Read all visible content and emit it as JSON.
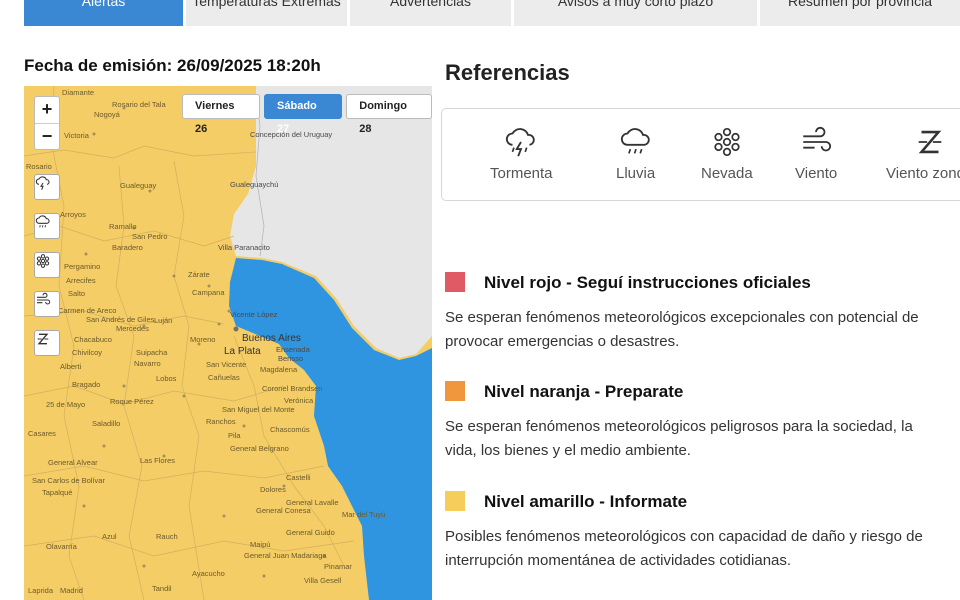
{
  "tabs": [
    {
      "label": "Alertas",
      "active": true
    },
    {
      "label": "Temperaturas Extremas",
      "active": false
    },
    {
      "label": "Advertencias",
      "active": false
    },
    {
      "label": "Avisos a muy corto plazo",
      "active": false
    },
    {
      "label": "Resumen por provincia",
      "active": false
    }
  ],
  "issue_date": "Fecha de emisión: 26/09/2025 18:20h",
  "map": {
    "zoom_in": "+",
    "zoom_out": "−",
    "day_tabs": [
      {
        "label": "Viernes 26",
        "active": false
      },
      {
        "label": "Sábado 27",
        "active": true
      },
      {
        "label": "Domingo 28",
        "active": false
      }
    ],
    "side_buttons": [
      "storm-icon",
      "rain-icon",
      "snow-icon",
      "wind-icon",
      "zonda-wind-icon"
    ],
    "places": [
      "Diamante",
      "Rosario del Tala",
      "Nogoyá",
      "Victoria",
      "Concepción del Uruguay",
      "Rosario",
      "Gualeguay",
      "Gualeguaychú",
      "Arroyos",
      "Ramallo",
      "San Pedro",
      "Baradero",
      "Villa Paranacito",
      "Pergamino",
      "Arrecifes",
      "Zárate",
      "Salto",
      "Campana",
      "Carmen de Areco",
      "San Andrés de Giles",
      "Luján",
      "Mercedes",
      "Vicente López",
      "Buenos Aires",
      "Ensenada",
      "Chacabuco",
      "Moreno",
      "La Plata",
      "Berisso",
      "Chivilcoy",
      "Suipacha",
      "Navarro",
      "San Vicente",
      "Magdalena",
      "Alberti",
      "Lobos",
      "Cañuelas",
      "Coronel Brandsen",
      "Bragado",
      "Roque Pérez",
      "Verónica",
      "25 de Mayo",
      "San Miguel del Monte",
      "Saladillo",
      "Ranchos",
      "Chascomús",
      "Pila",
      "Casares",
      "General Alvear",
      "Las Flores",
      "General Belgrano",
      "Castelli",
      "San Carlos de Bolívar",
      "Dolores",
      "Tapalqué",
      "General Lavalle",
      "General Conesa",
      "Mar del Tuyú",
      "Azul",
      "Rauch",
      "General Guido",
      "Olavarría",
      "Maipú",
      "General Juan Madariaga",
      "Pinamar",
      "Ayacucho",
      "Villa Gesell",
      "Tandil",
      "Laprida",
      "Madrid"
    ]
  },
  "references": {
    "title": "Referencias",
    "items": [
      {
        "label": "Tormenta",
        "icon": "storm-icon"
      },
      {
        "label": "Lluvia",
        "icon": "rain-icon"
      },
      {
        "label": "Nevada",
        "icon": "snow-icon"
      },
      {
        "label": "Viento",
        "icon": "wind-icon"
      },
      {
        "label": "Viento zonda",
        "icon": "zonda-wind-icon"
      }
    ]
  },
  "levels": [
    {
      "color": "#e05a66",
      "title": "Nivel rojo - Seguí instrucciones oficiales",
      "line1": "Se esperan fenómenos meteorológicos excepcionales con potencial de",
      "line2": "provocar emergencias o desastres."
    },
    {
      "color": "#f0963c",
      "title": "Nivel naranja - Preparate",
      "line1": "Se esperan fenómenos meteorológicos peligrosos para la sociedad, la",
      "line2": "vida, los bienes y el medio ambiente."
    },
    {
      "color": "#f6cd5a",
      "title": "Nivel amarillo - Informate",
      "line1": "Posibles fenómenos meteorológicos con capacidad de daño y riesgo de",
      "line2": "interrupción momentánea de actividades cotidianas."
    }
  ],
  "colors": {
    "accent": "#3a87d4",
    "alert_yellow": "#f4cd67",
    "water": "#2f95e0",
    "land_neutral": "#e6e6e6"
  }
}
